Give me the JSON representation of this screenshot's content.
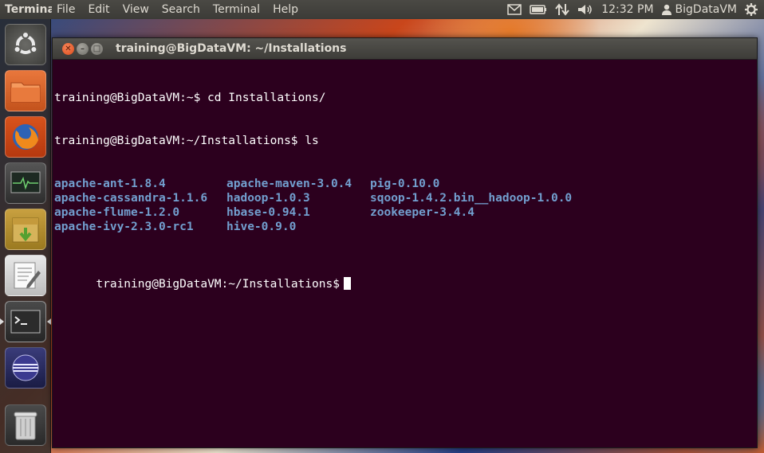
{
  "top_panel": {
    "app_title": "Terminal",
    "menu": [
      "File",
      "Edit",
      "View",
      "Search",
      "Terminal",
      "Help"
    ],
    "clock": "12:32 PM",
    "user": "BigDataVM",
    "icons": [
      "mail-icon",
      "battery-icon",
      "network-icon",
      "volume-icon",
      "user-icon",
      "gear-icon"
    ]
  },
  "launcher": {
    "items": [
      "dash-home",
      "files",
      "firefox",
      "system-monitor",
      "archive-manager",
      "text-editor",
      "terminal",
      "eclipse",
      "trash"
    ]
  },
  "terminal": {
    "title": "training@BigDataVM: ~/Installations",
    "lines": [
      "training@BigDataVM:~$ cd Installations/",
      "training@BigDataVM:~/Installations$ ls"
    ],
    "ls_output": [
      "apache-ant-1.8.4",
      "apache-maven-3.0.4",
      "pig-0.10.0",
      "apache-cassandra-1.1.6",
      "hadoop-1.0.3",
      "sqoop-1.4.2.bin__hadoop-1.0.0",
      "apache-flume-1.2.0",
      "hbase-0.94.1",
      "zookeeper-3.4.4",
      "apache-ivy-2.3.0-rc1",
      "hive-0.9.0",
      ""
    ],
    "prompt": "training@BigDataVM:~/Installations$"
  },
  "colors": {
    "terminal_bg": "#2c001e",
    "directory_color": "#729fcf",
    "panel_bg": "#3c3b37"
  }
}
